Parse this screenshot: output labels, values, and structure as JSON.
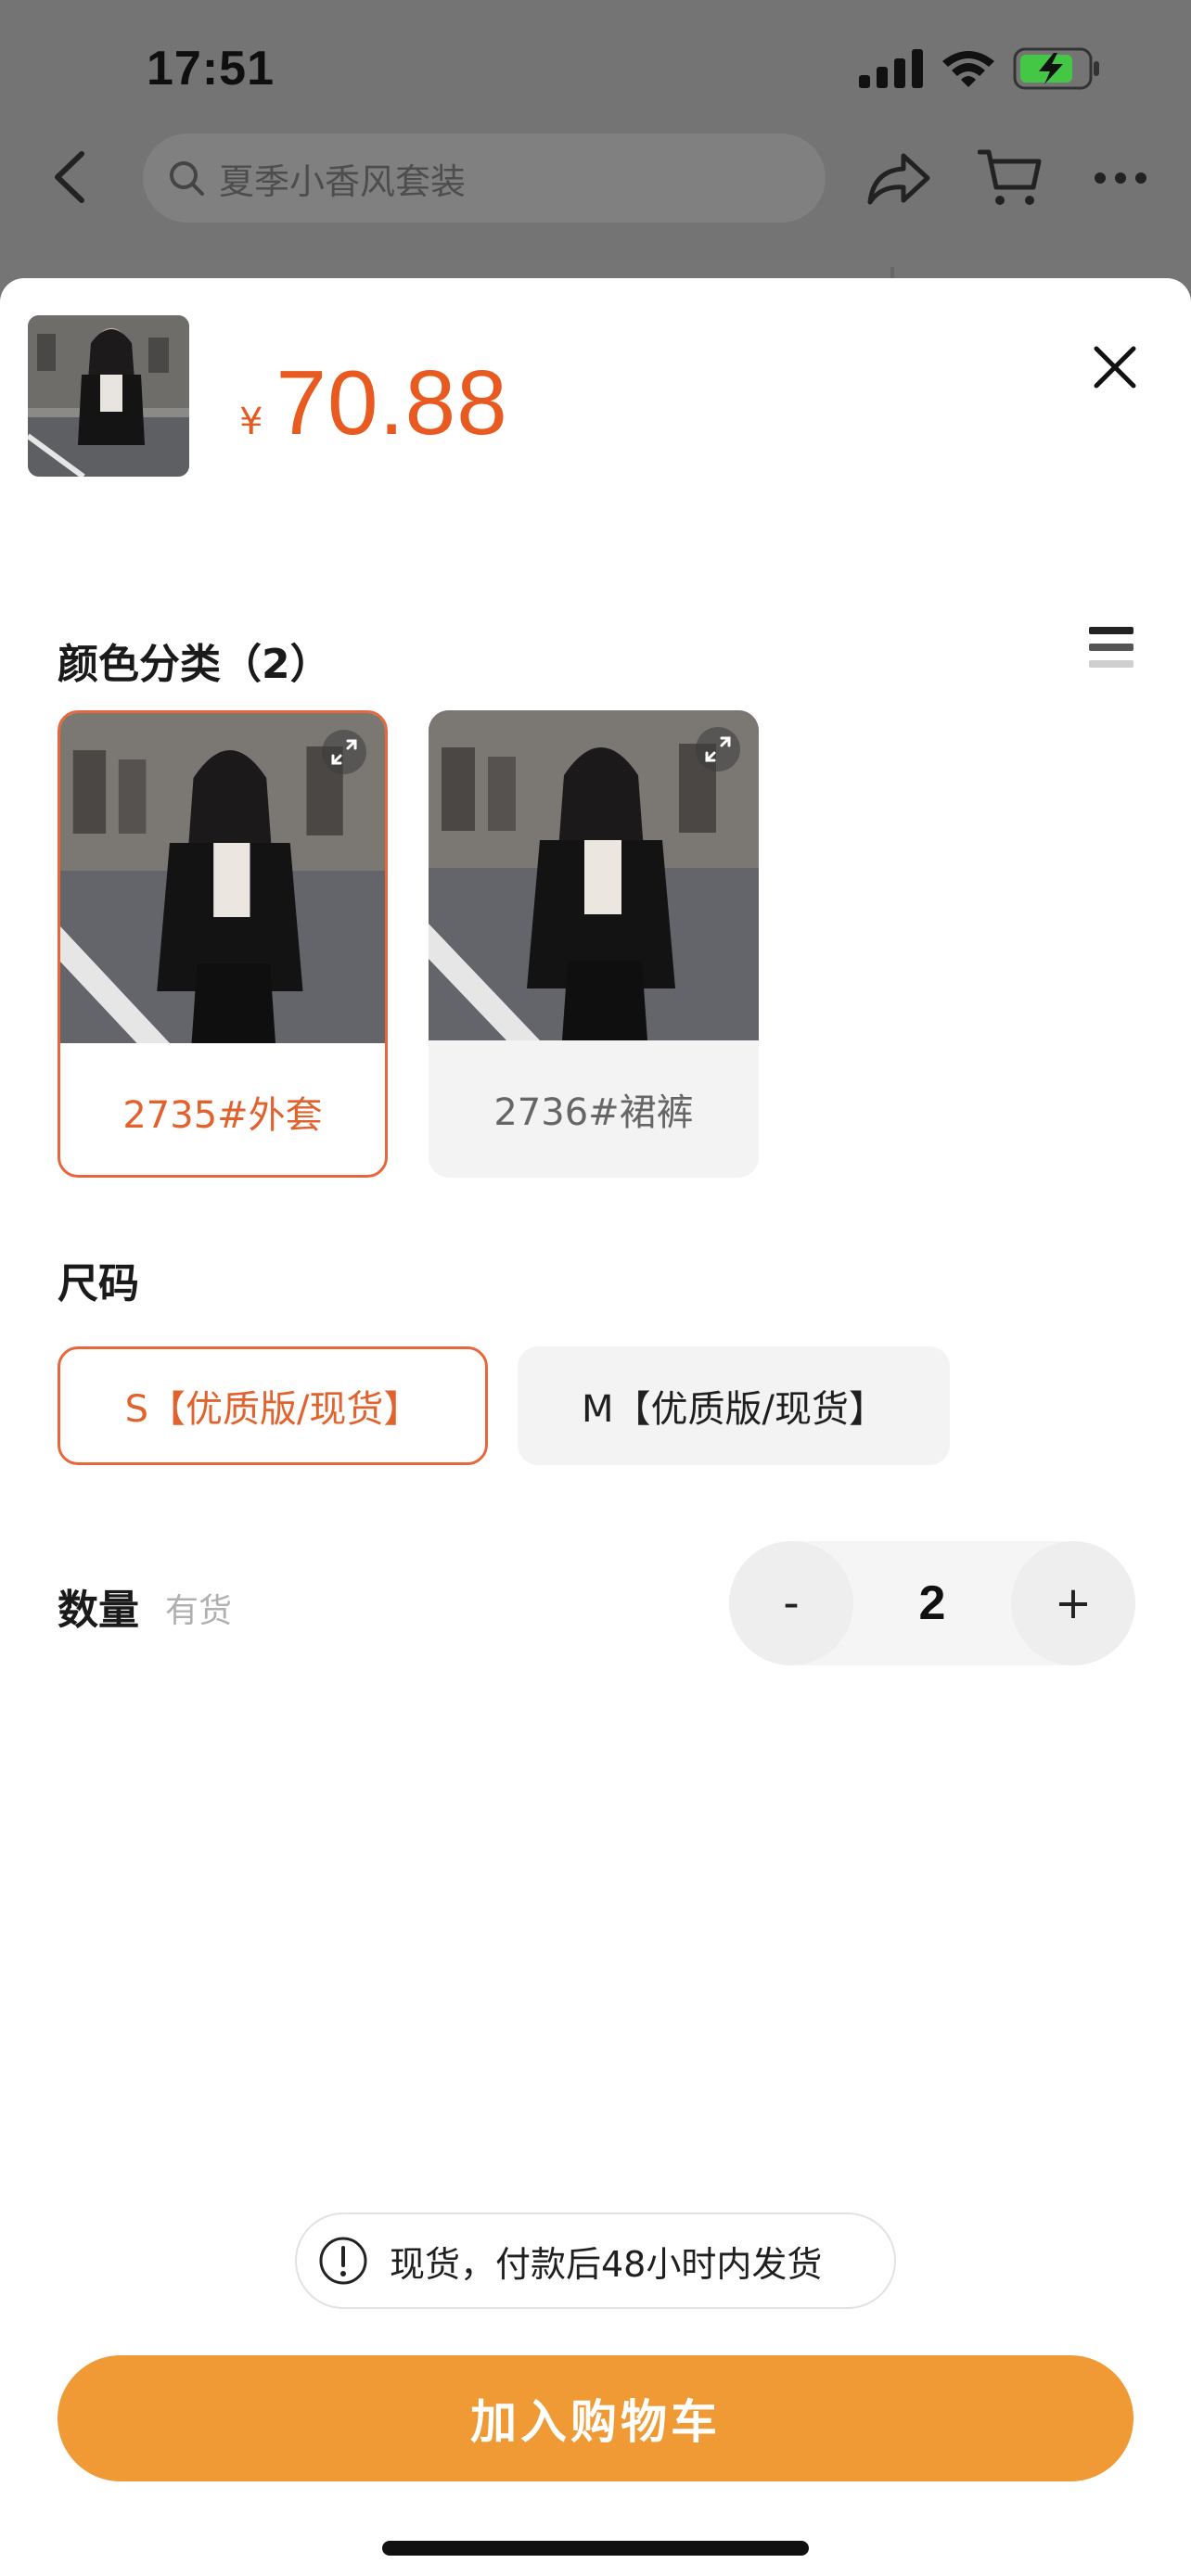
{
  "status_bar": {
    "time": "17:51"
  },
  "nav": {
    "search_placeholder": "夏季小香风套装"
  },
  "product": {
    "currency": "¥",
    "price": "70.88"
  },
  "color_section": {
    "title": "颜色分类（2）",
    "options": [
      {
        "label": "2735#外套",
        "selected": true
      },
      {
        "label": "2736#裙裤",
        "selected": false
      }
    ]
  },
  "size_section": {
    "title": "尺码",
    "options": [
      {
        "label": "S【优质版/现货】",
        "selected": true
      },
      {
        "label": "M【优质版/现货】",
        "selected": false
      }
    ]
  },
  "quantity": {
    "label": "数量",
    "stock_status": "有货",
    "minus_label": "-",
    "value": "2",
    "plus_label": "+"
  },
  "notice": {
    "text": "现货，付款后48小时内发货"
  },
  "cart_button": {
    "label": "加入购物车"
  },
  "colors": {
    "accent": "#e85a1f",
    "selected_border": "#e8673a",
    "cart_button_bg": "#f09a36",
    "option_bg": "#f3f3f3"
  },
  "icons": [
    "back-icon",
    "search-icon",
    "share-icon",
    "cart-icon",
    "more-icon",
    "close-icon",
    "list-icon",
    "expand-icon",
    "info-icon"
  ]
}
